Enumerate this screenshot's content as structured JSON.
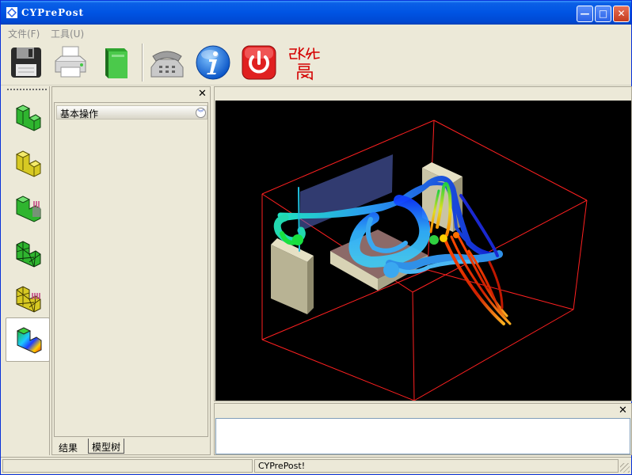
{
  "window": {
    "title": "CYPrePost"
  },
  "title_buttons": {
    "minimize": "—",
    "maximize": "□",
    "close": "✕"
  },
  "menu": {
    "file": "文件(F)",
    "tools": "工具(U)"
  },
  "toolbar": {
    "items": [
      "save-icon",
      "printer-icon",
      "book-icon",
      "telephone-icon",
      "info-icon",
      "power-icon"
    ],
    "signature": "张纯禹"
  },
  "left_tools": [
    "solid-model-icon",
    "solid-yellow-icon",
    "boundary-load-icon",
    "mesh-icon",
    "mesh-load-icon",
    "result-contour-icon"
  ],
  "panel": {
    "close": "✕",
    "section_title": "基本操作",
    "toggle": "︾",
    "tabs": [
      "结果",
      "模型树"
    ]
  },
  "output": {
    "close": "✕"
  },
  "status": {
    "message": "CYPrePost!"
  },
  "colors": {
    "title_bar": "#0054e3",
    "viewport_bg": "#000000",
    "bounding_box": "#ff2020",
    "face": "#ece9d8"
  }
}
